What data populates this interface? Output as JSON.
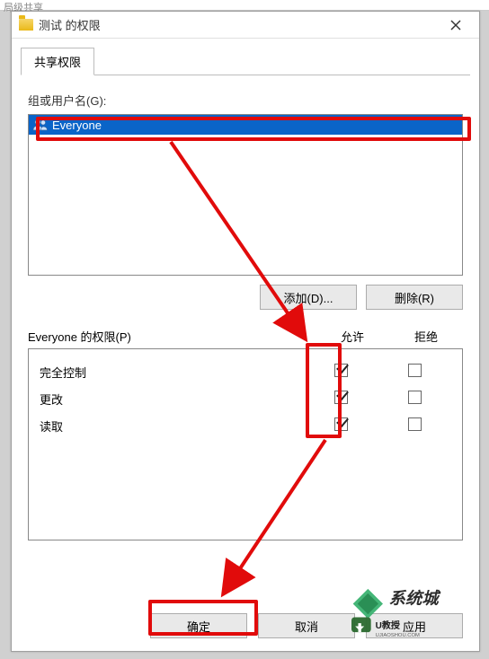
{
  "bg_hint": "局级共享",
  "titlebar": {
    "title": "测试 的权限"
  },
  "tab": {
    "label": "共享权限"
  },
  "groups_label": "组或用户名(G):",
  "list": {
    "selected_name": "Everyone"
  },
  "buttons": {
    "add": "添加(D)...",
    "remove": "删除(R)",
    "ok": "确定",
    "cancel": "取消",
    "apply": "应用"
  },
  "perm_section_label": "Everyone 的权限(P)",
  "columns": {
    "allow": "允许",
    "deny": "拒绝"
  },
  "permissions": [
    {
      "name": "完全控制",
      "allow": true,
      "deny": false
    },
    {
      "name": "更改",
      "allow": true,
      "deny": false
    },
    {
      "name": "读取",
      "allow": true,
      "deny": false
    }
  ]
}
